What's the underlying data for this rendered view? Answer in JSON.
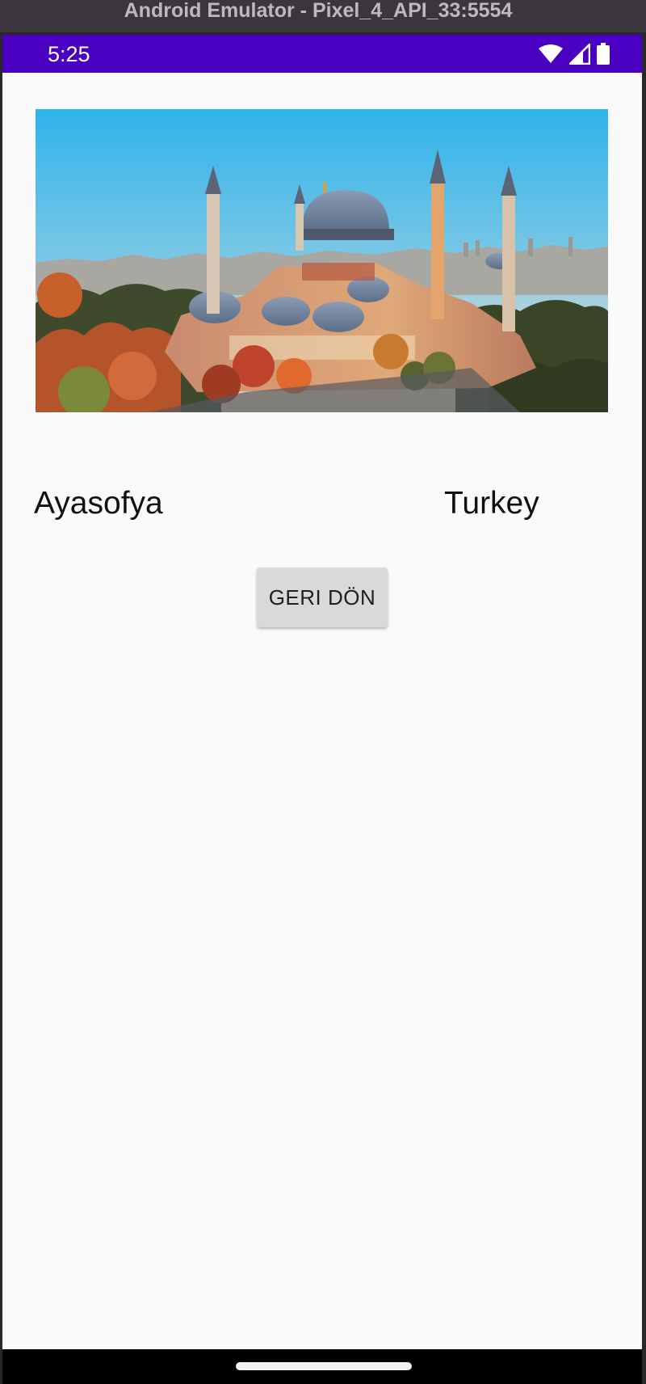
{
  "window": {
    "title": "Android Emulator - Pixel_4_API_33:5554"
  },
  "status_bar": {
    "time": "5:25",
    "icons": [
      "wifi-icon",
      "cellular-signal-icon",
      "battery-icon"
    ],
    "background_color": "#4a00c0"
  },
  "detail": {
    "image_alt": "Ayasofya",
    "place_name": "Ayasofya",
    "country": "Turkey",
    "back_button_label": "GERI DÖN"
  },
  "nav_bar": {
    "icons": [
      "home-handle"
    ]
  }
}
